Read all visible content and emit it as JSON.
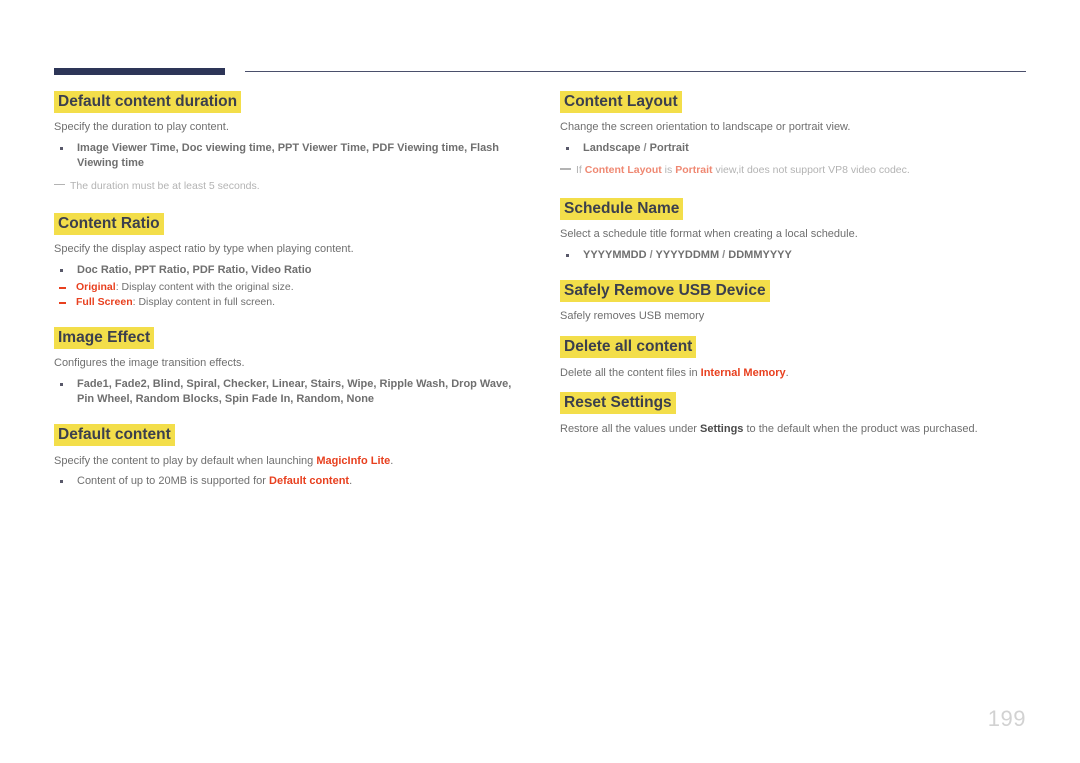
{
  "page": {
    "number": "199",
    "colors": {
      "highlight": "#f3de4a",
      "heading_text": "#3b3f4d",
      "accent_red": "#e8401f",
      "body_text": "#6f6f6f",
      "note_text": "#b3b3b3",
      "rule_navy": "#2d3557",
      "page_number": "#d2d2d2"
    }
  },
  "left_column": {
    "sections": [
      {
        "heading": "Default content duration",
        "body": "Specify the duration to play content.",
        "bullets": [
          "Image Viewer Time, Doc viewing time, PPT Viewer Time, PDF Viewing time, Flash Viewing time"
        ],
        "note": "The duration must be at least 5 seconds."
      },
      {
        "heading": "Content Ratio",
        "body": "Specify the display aspect ratio by type when playing content.",
        "bullets": [
          "Doc Ratio, PPT Ratio, PDF Ratio, Video Ratio"
        ],
        "subbullets": [
          {
            "term": "Original",
            "desc": ": Display content with the original size."
          },
          {
            "term": "Full Screen",
            "desc": ": Display content in full screen."
          }
        ]
      },
      {
        "heading": "Image Effect",
        "body": "Configures the image transition effects.",
        "bullets": [
          "Fade1, Fade2, Blind, Spiral, Checker, Linear, Stairs, Wipe, Ripple Wash, Drop Wave, Pin Wheel, Random Blocks, Spin Fade In, Random, None"
        ]
      },
      {
        "heading": "Default content",
        "body_parts": {
          "pre": "Specify the content to play by default when launching ",
          "kw": "MagicInfo Lite",
          "post": "."
        },
        "plain_bullet": {
          "pre": "Content of up to 20MB is supported for ",
          "kw": "Default content",
          "post": "."
        }
      }
    ]
  },
  "right_column": {
    "sections": [
      {
        "heading": "Content Layout",
        "body": "Change the screen orientation to landscape or portrait view.",
        "bullet_parts": {
          "a": "Landscape",
          "sep": " / ",
          "b": "Portrait"
        },
        "note_parts": {
          "p1": "If ",
          "kw1": "Content Layout",
          "p2": " is ",
          "kw2": "Portrait",
          "p3": " view,it does not support VP8 video codec."
        }
      },
      {
        "heading": "Schedule Name",
        "body": "Select a schedule title format when creating a local schedule.",
        "bullet_parts": {
          "a": "YYYYMMDD",
          "sep1": " / ",
          "b": "YYYYDDMM",
          "sep2": " / ",
          "c": "DDMMYYYY"
        }
      },
      {
        "heading": "Safely Remove USB Device",
        "body": "Safely removes USB memory"
      },
      {
        "heading": "Delete all content",
        "body_parts": {
          "pre": "Delete all the content files in ",
          "kw": "Internal Memory",
          "post": "."
        }
      },
      {
        "heading": "Reset Settings",
        "body_parts": {
          "pre": "Restore all the values under ",
          "kw": "Settings",
          "post": " to the default when the product was purchased."
        }
      }
    ]
  }
}
